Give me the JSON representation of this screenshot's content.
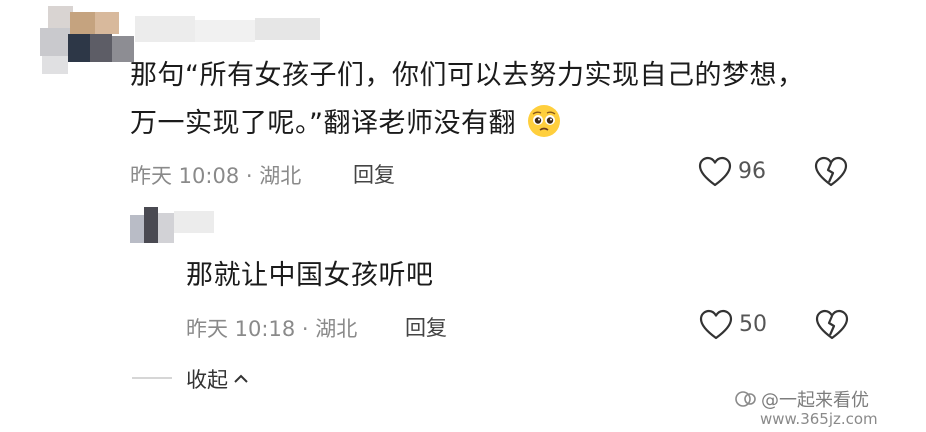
{
  "comments": [
    {
      "text_line1": "那句“所有女孩子们，你们可以去努力实现自己的梦想，",
      "text_line2": "万一实现了呢。”翻译老师没有翻",
      "emoji": "pleading-face-emoji",
      "time": "昨天 10:08",
      "location": "湖北",
      "reply_label": "回复",
      "likes": "96"
    },
    {
      "text": "那就让中国女孩听吧",
      "time": "昨天 10:18",
      "location": "湖北",
      "reply_label": "回复",
      "likes": "50"
    }
  ],
  "collapse_label": "收起",
  "watermark": {
    "text": "@一起来看优",
    "url": "www.365jz.com"
  },
  "colors": {
    "icon": "#333333",
    "meta": "#8a8a8a",
    "emoji": "#ffcf3d"
  },
  "icons": [
    "heart-outline-icon",
    "broken-heart-icon",
    "chevron-up-icon"
  ]
}
